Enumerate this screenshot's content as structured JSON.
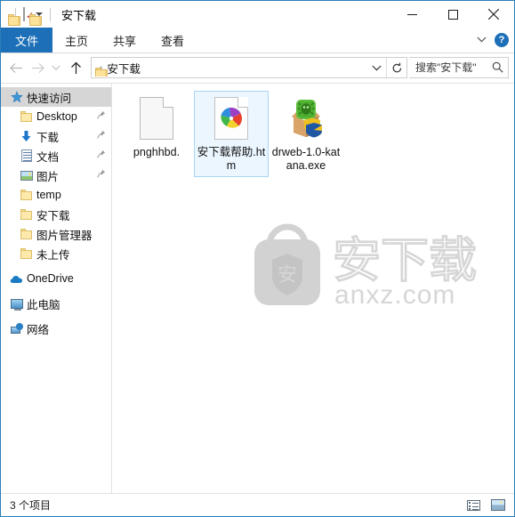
{
  "window": {
    "title": "安下载",
    "quick_access_toolbar": [
      {
        "name": "properties-folder-icon",
        "label": ""
      },
      {
        "name": "properties-icon",
        "label": ""
      },
      {
        "name": "new-folder-icon",
        "label": ""
      },
      {
        "name": "customize-qat-dropdown",
        "label": ""
      }
    ],
    "controls": {
      "minimize": "—",
      "maximize": "□",
      "close": "✕"
    }
  },
  "ribbon": {
    "tabs": [
      {
        "label": "文件",
        "active": true
      },
      {
        "label": "主页",
        "active": false
      },
      {
        "label": "共享",
        "active": false
      },
      {
        "label": "查看",
        "active": false
      }
    ],
    "collapse_label": "⌄",
    "help_label": "?"
  },
  "navbar": {
    "back": "←",
    "forward": "→",
    "recent": "⌄",
    "up": "↑",
    "address": {
      "separator": "›",
      "path": "安下载",
      "dropdown": "⌄",
      "refresh": "↻"
    },
    "search": {
      "placeholder": "搜索\"安下载\"",
      "value": "",
      "icon": "⌕"
    }
  },
  "sidebar": {
    "items": [
      {
        "label": "快速访问",
        "icon": "star-icon",
        "selected": true,
        "pinned": false,
        "indent": 0
      },
      {
        "label": "Desktop",
        "icon": "folder-icon",
        "selected": false,
        "pinned": true,
        "indent": 1
      },
      {
        "label": "下载",
        "icon": "download-arrow-icon",
        "selected": false,
        "pinned": true,
        "indent": 1
      },
      {
        "label": "文档",
        "icon": "documents-icon",
        "selected": false,
        "pinned": true,
        "indent": 1
      },
      {
        "label": "图片",
        "icon": "pictures-icon",
        "selected": false,
        "pinned": true,
        "indent": 1
      },
      {
        "label": "temp",
        "icon": "folder-icon",
        "selected": false,
        "pinned": false,
        "indent": 1
      },
      {
        "label": "安下载",
        "icon": "folder-icon",
        "selected": false,
        "pinned": false,
        "indent": 1
      },
      {
        "label": "图片管理器",
        "icon": "folder-icon",
        "selected": false,
        "pinned": false,
        "indent": 1
      },
      {
        "label": "未上传",
        "icon": "folder-icon",
        "selected": false,
        "pinned": false,
        "indent": 1
      },
      {
        "label": "OneDrive",
        "icon": "cloud-icon",
        "selected": false,
        "pinned": false,
        "indent": 0
      },
      {
        "label": "此电脑",
        "icon": "this-pc-icon",
        "selected": false,
        "pinned": false,
        "indent": 0
      },
      {
        "label": "网络",
        "icon": "network-icon",
        "selected": false,
        "pinned": false,
        "indent": 0
      }
    ],
    "pin_glyph": "📌"
  },
  "files": [
    {
      "name": "pnghhbd.",
      "icon": "blank-document-icon",
      "selected": false
    },
    {
      "name": "安下载帮助.htm",
      "icon": "html-document-icon",
      "selected": true
    },
    {
      "name": "drweb-1.0-katana.exe",
      "icon": "drweb-katana-icon",
      "selected": false
    }
  ],
  "watermark": {
    "text": "安下载",
    "domain": "anxz.com",
    "shield_char": "安"
  },
  "statusbar": {
    "item_count": "3 个项目",
    "views": [
      {
        "name": "details-view-button",
        "active": false
      },
      {
        "name": "large-icons-view-button",
        "active": true
      }
    ]
  },
  "colors": {
    "accent": "#1d70b8",
    "window_border": "#2a7fbb",
    "selection_fill": "#cce8ff",
    "selection_border": "#a8d5f2",
    "sidebar_selected": "#d6d6d6",
    "folder_yellow": "#fde39a"
  }
}
